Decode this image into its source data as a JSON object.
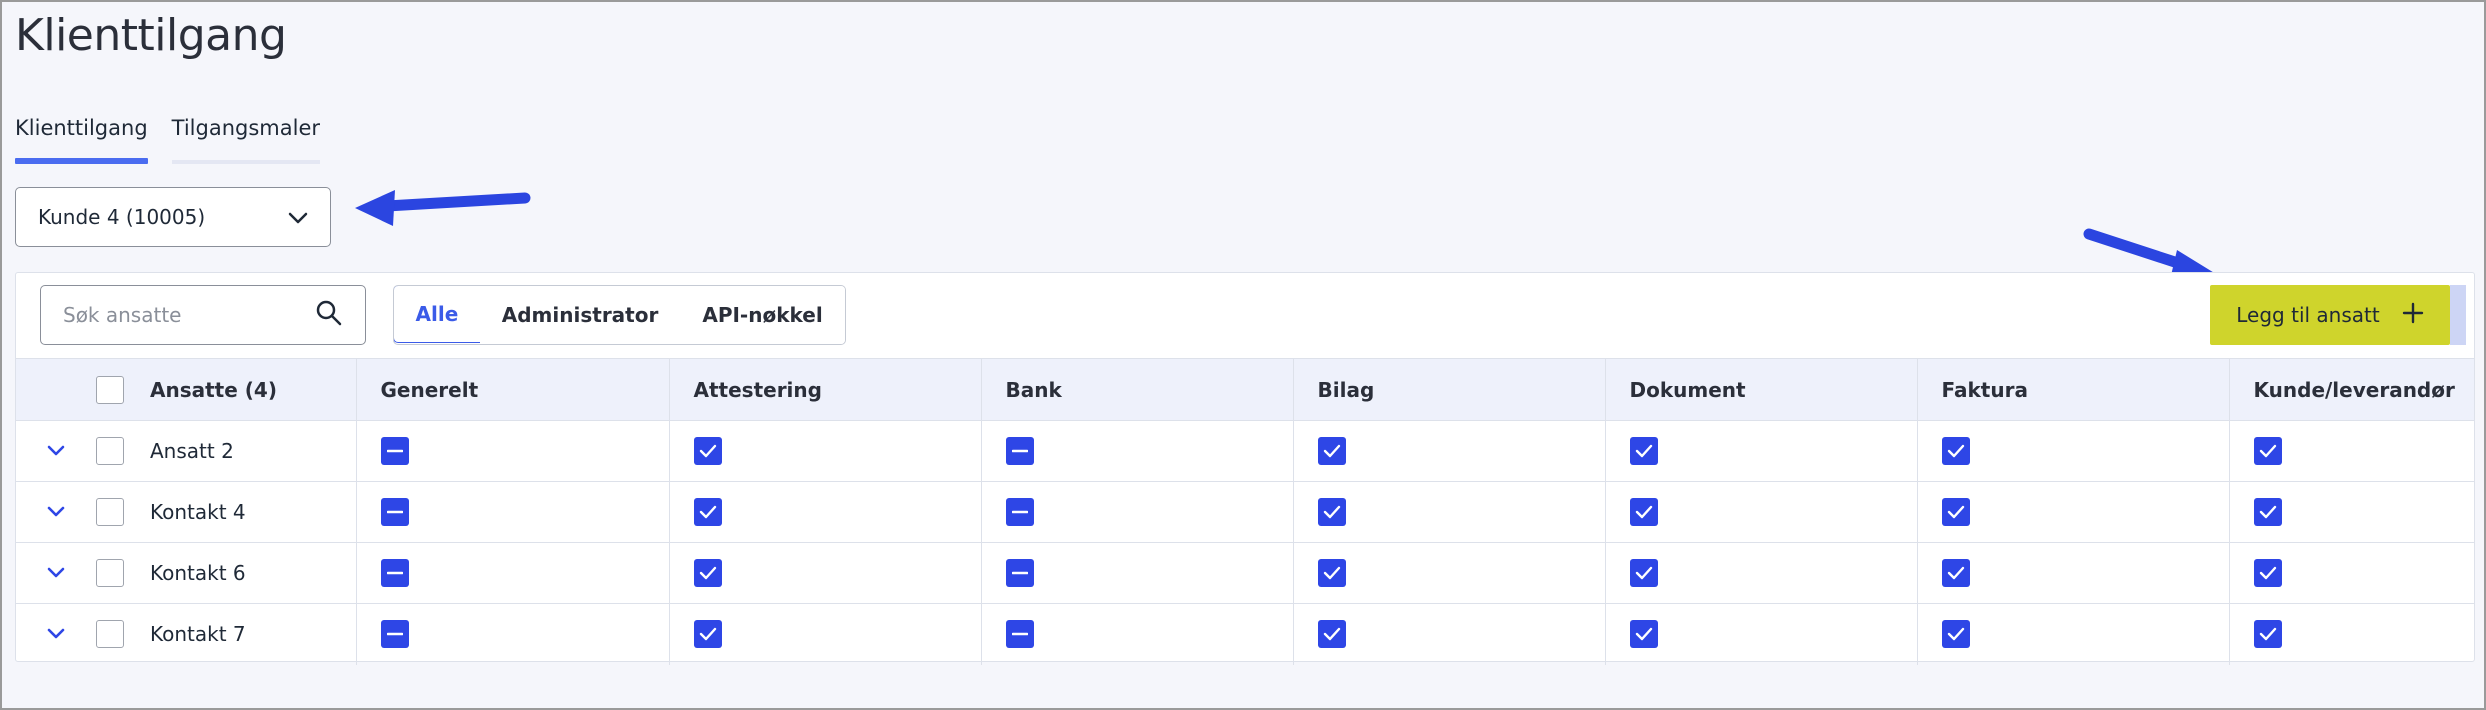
{
  "page": {
    "title": "Klienttilgang"
  },
  "tabs": [
    {
      "label": "Klienttilgang",
      "active": true
    },
    {
      "label": "Tilgangsmaler",
      "active": false
    }
  ],
  "client_select": {
    "value": "Kunde 4 (10005)"
  },
  "toolbar": {
    "search_placeholder": "Søk ansatte",
    "filters": [
      {
        "label": "Alle",
        "active": true
      },
      {
        "label": "Administrator",
        "active": false
      },
      {
        "label": "API-nøkkel",
        "active": false
      }
    ],
    "add_label": "Legg til ansatt"
  },
  "table": {
    "columns": [
      "Ansatte (4)",
      "Generelt",
      "Attestering",
      "Bank",
      "Bilag",
      "Dokument",
      "Faktura",
      "Kunde/leverandør"
    ],
    "rows": [
      {
        "name": "Ansatt 2",
        "states": [
          "partial",
          "checked",
          "partial",
          "checked",
          "checked",
          "checked",
          "checked"
        ]
      },
      {
        "name": "Kontakt 4",
        "states": [
          "partial",
          "checked",
          "partial",
          "checked",
          "checked",
          "checked",
          "checked"
        ]
      },
      {
        "name": "Kontakt 6",
        "states": [
          "partial",
          "checked",
          "partial",
          "checked",
          "checked",
          "checked",
          "checked"
        ]
      },
      {
        "name": "Kontakt 7",
        "states": [
          "partial",
          "checked",
          "partial",
          "checked",
          "checked",
          "checked",
          "checked"
        ]
      }
    ]
  },
  "colors": {
    "accent": "#2e46e6",
    "add_button": "#cfd42c",
    "annotation_arrow": "#2b45e0"
  }
}
